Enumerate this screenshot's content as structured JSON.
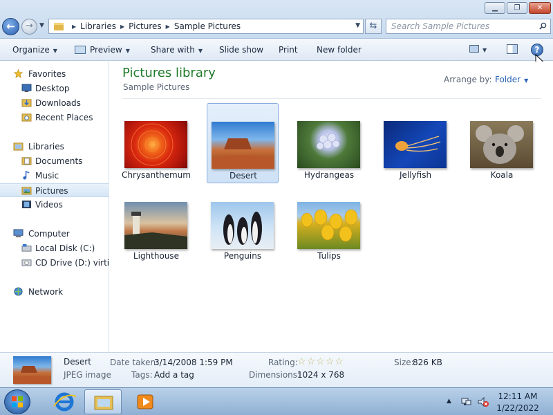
{
  "address_bar": {
    "crumbs": [
      "Libraries",
      "Pictures",
      "Sample Pictures"
    ],
    "search_placeholder": "Search Sample Pictures"
  },
  "toolbar": {
    "organize": "Organize",
    "preview": "Preview",
    "share_with": "Share with",
    "slide_show": "Slide show",
    "print": "Print",
    "new_folder": "New folder"
  },
  "sidebar": {
    "favorites": {
      "label": "Favorites",
      "items": [
        "Desktop",
        "Downloads",
        "Recent Places"
      ]
    },
    "libraries": {
      "label": "Libraries",
      "items": [
        "Documents",
        "Music",
        "Pictures",
        "Videos"
      ],
      "selected": "Pictures"
    },
    "computer": {
      "label": "Computer",
      "items": [
        "Local Disk (C:)",
        "CD Drive (D:) virtio-w"
      ]
    },
    "network": {
      "label": "Network"
    }
  },
  "main": {
    "title": "Pictures library",
    "subtitle": "Sample Pictures",
    "arrange_label": "Arrange by:",
    "arrange_value": "Folder",
    "items": [
      "Chrysanthemum",
      "Desert",
      "Hydrangeas",
      "Jellyfish",
      "Koala",
      "Lighthouse",
      "Penguins",
      "Tulips"
    ],
    "selected": "Desert"
  },
  "details": {
    "name": "Desert",
    "type": "JPEG image",
    "date_taken_label": "Date taken:",
    "date_taken": "3/14/2008 1:59 PM",
    "tags_label": "Tags:",
    "tags": "Add a tag",
    "rating_label": "Rating:",
    "rating": 0,
    "rating_max": 5,
    "dimensions_label": "Dimensions:",
    "dimensions": "1024 x 768",
    "size_label": "Size:",
    "size": "826 KB"
  },
  "taskbar": {
    "time": "12:11 AM",
    "date": "1/22/2022"
  },
  "colors": {
    "library_title": "#1f7a2a",
    "selection": "#cfe1f6",
    "link": "#2a63b8"
  }
}
